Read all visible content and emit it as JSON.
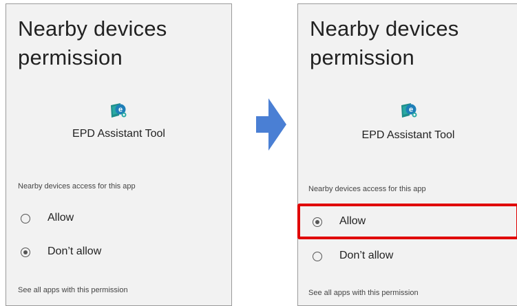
{
  "left_screen": {
    "title_line1": "Nearby devices",
    "title_line2": "permission",
    "app_name": "EPD Assistant Tool",
    "app_icon_letter": "e",
    "section_label": "Nearby devices access for this app",
    "options": [
      {
        "label": "Allow",
        "selected": false
      },
      {
        "label": "Don’t allow",
        "selected": true
      }
    ],
    "footer_link": "See all apps with this permission"
  },
  "right_screen": {
    "title_line1": "Nearby devices",
    "title_line2": "permission",
    "app_name": "EPD Assistant Tool",
    "app_icon_letter": "e",
    "section_label": "Nearby devices access for this app",
    "options": [
      {
        "label": "Allow",
        "selected": true
      },
      {
        "label": "Don’t allow",
        "selected": false
      }
    ],
    "footer_link": "See all apps with this permission"
  },
  "colors": {
    "screen_bg": "#f2f2f2",
    "arrow": "#4a7fd4",
    "highlight": "#e00000",
    "icon_teal": "#1e8e8a"
  },
  "icons": {
    "app_icon": "epd-assistant-app-icon",
    "step_arrow": "right-arrow-icon"
  }
}
